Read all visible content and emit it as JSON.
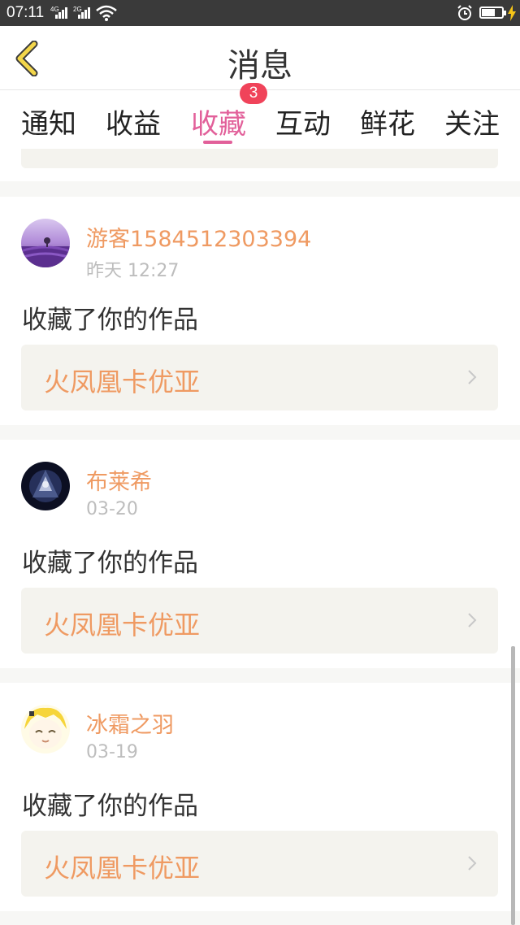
{
  "status_bar": {
    "time": "07:11",
    "network1": "4G",
    "network2": "2G"
  },
  "header": {
    "title": "消息"
  },
  "tabs": [
    {
      "label": "通知"
    },
    {
      "label": "收益"
    },
    {
      "label": "收藏",
      "active": true,
      "badge": "3"
    },
    {
      "label": "互动"
    },
    {
      "label": "鲜花"
    },
    {
      "label": "关注"
    }
  ],
  "items": [
    {
      "username": "游客1584512303394",
      "time": "昨天 12:27",
      "action": "收藏了你的作品",
      "work_title": "火凤凰卡优亚",
      "avatar": "lavender-field-avatar"
    },
    {
      "username": "布莱希",
      "time": "03-20",
      "action": "收藏了你的作品",
      "work_title": "火凤凰卡优亚",
      "avatar": "dark-anime-avatar"
    },
    {
      "username": "冰霜之羽",
      "time": "03-19",
      "action": "收藏了你的作品",
      "work_title": "火凤凰卡优亚",
      "avatar": "yellow-anime-avatar"
    }
  ],
  "colors": {
    "accent": "#e2609a",
    "name": "#ef9a62",
    "badge": "#f0435a",
    "back_arrow": "#f3d64a"
  }
}
